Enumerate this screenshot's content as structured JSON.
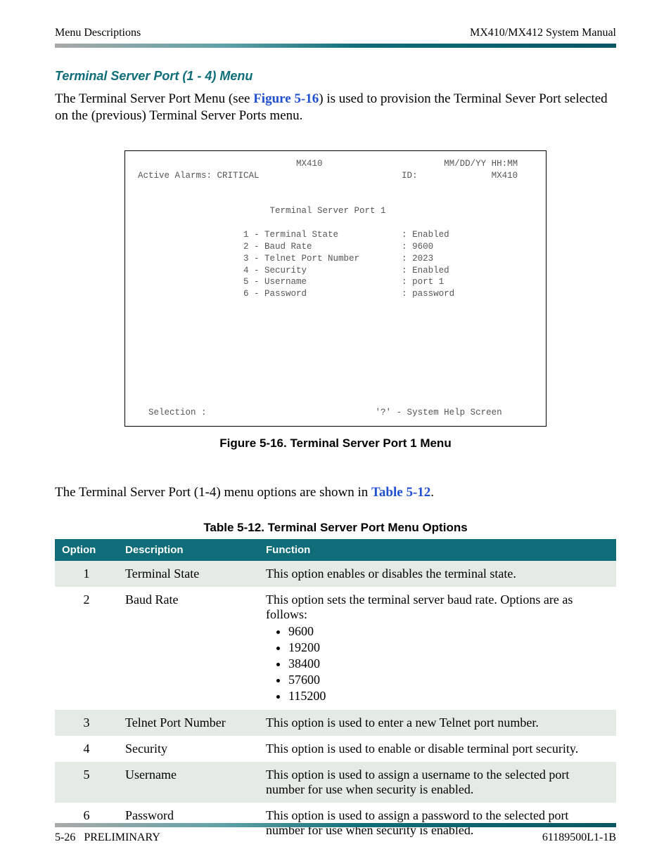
{
  "header": {
    "left": "Menu Descriptions",
    "right": "MX410/MX412 System Manual"
  },
  "section": {
    "heading": "Terminal Server Port (1 - 4) Menu",
    "intro_pre": "The Terminal Server Port Menu (see ",
    "intro_ref": "Figure 5-16",
    "intro_post": ") is used to provision the Terminal Sever Port selected on the (previous) Terminal Server Ports menu.",
    "after_pre": "The Terminal Server Port (1-4) menu options are shown in ",
    "after_ref": "Table 5-12",
    "after_post": "."
  },
  "terminal": {
    "line1_left": "                              MX410",
    "line1_right": "MM/DD/YY HH:MM",
    "line2_left": "Active Alarms: CRITICAL",
    "line2_mid": "ID:",
    "line2_right": "MX410",
    "title": "Terminal Server Port 1",
    "rows": [
      {
        "n": "1",
        "label": "Terminal State",
        "value": "Enabled"
      },
      {
        "n": "2",
        "label": "Baud Rate",
        "value": "9600"
      },
      {
        "n": "3",
        "label": "Telnet Port Number",
        "value": "2023"
      },
      {
        "n": "4",
        "label": "Security",
        "value": "Enabled"
      },
      {
        "n": "5",
        "label": "Username",
        "value": "port 1"
      },
      {
        "n": "6",
        "label": "Password",
        "value": "password"
      }
    ],
    "selection": "Selection :",
    "help": "'?' - System Help Screen"
  },
  "figure_caption": "Figure 5-16.  Terminal Server Port 1 Menu",
  "table_caption": "Table 5-12.  Terminal Server Port Menu Options",
  "table": {
    "head": {
      "option": "Option",
      "description": "Description",
      "function": "Function"
    },
    "rows": [
      {
        "option": "1",
        "description": "Terminal State",
        "function": "This option enables or disables the terminal state."
      },
      {
        "option": "2",
        "description": "Baud Rate",
        "function_intro": "This option sets the terminal server baud rate. Options are as follows:",
        "bullets": [
          "9600",
          "19200",
          "38400",
          "57600",
          "115200"
        ]
      },
      {
        "option": "3",
        "description": "Telnet Port Number",
        "function": "This option is used to enter a new Telnet port number."
      },
      {
        "option": "4",
        "description": "Security",
        "function": "This option is used to enable or disable terminal port security."
      },
      {
        "option": "5",
        "description": "Username",
        "function": "This option is used to assign a username to the selected port number for use when security is enabled."
      },
      {
        "option": "6",
        "description": "Password",
        "function": "This option is used to assign a password to the selected port number for use when security is enabled."
      }
    ]
  },
  "footer": {
    "left_page": "5-26",
    "left_tag": "PRELIMINARY",
    "right": "61189500L1-1B"
  }
}
